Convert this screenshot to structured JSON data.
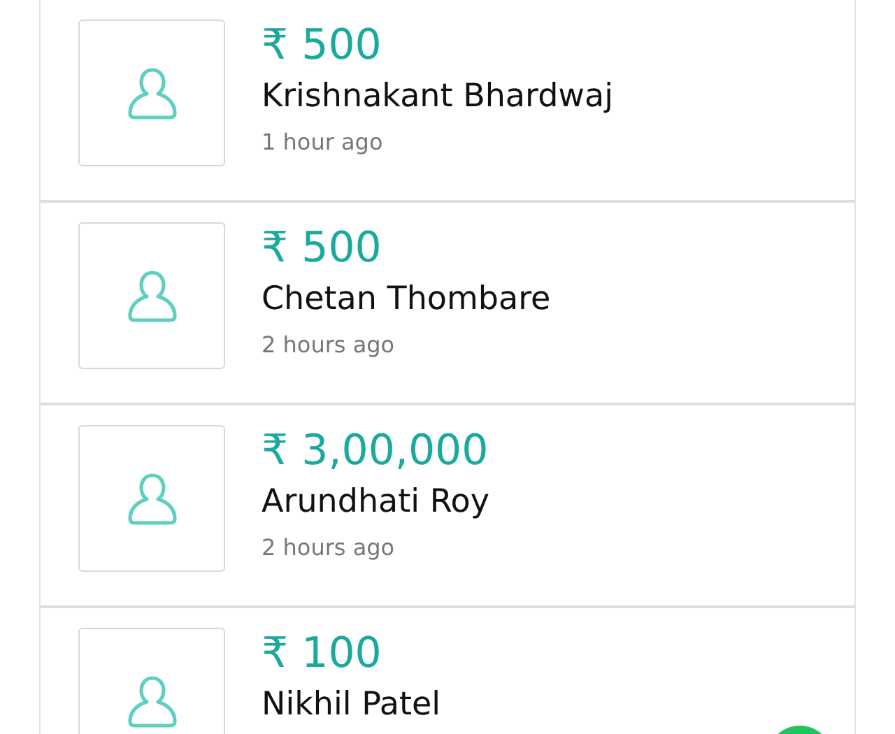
{
  "donations": [
    {
      "amount": "₹ 500",
      "name": "Krishnakant Bhardwaj",
      "time": "1 hour ago"
    },
    {
      "amount": "₹ 500",
      "name": "Chetan Thombare",
      "time": "2 hours ago"
    },
    {
      "amount": "₹ 3,00,000",
      "name": "Arundhati Roy",
      "time": "2 hours ago"
    },
    {
      "amount": "₹ 100",
      "name": "Nikhil Patel"
    }
  ]
}
